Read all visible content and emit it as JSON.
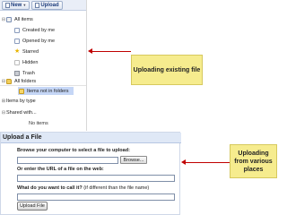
{
  "toolbar": {
    "new_label": "New",
    "upload_label": "Upload"
  },
  "list": {
    "all_items": "All items",
    "created_by_me": "Created by me",
    "opened_by_me": "Opened by me",
    "starred": "Starred",
    "hidden": "Hidden",
    "trash": "Trash",
    "all_folders": "All folders",
    "items_not_in_folders": "Items not in folders",
    "items_by_type": "Items by type",
    "shared_with": "Shared with...",
    "no_items": "No items"
  },
  "callouts": {
    "existing": "Uploading existing file",
    "various": "Uploading from various places"
  },
  "upload": {
    "title": "Upload a File",
    "browse_label": "Browse your computer to select a file to upload:",
    "browse_button": "Browse...",
    "url_label": "Or enter the URL of a file on the web:",
    "name_label": "What do you want to call it?",
    "name_note": "(if different than the file name)",
    "upload_button": "Upload File"
  },
  "colors": {
    "arrow": "#c00000",
    "callout": "#f6ec8e",
    "selection": "#c5d6f6"
  }
}
